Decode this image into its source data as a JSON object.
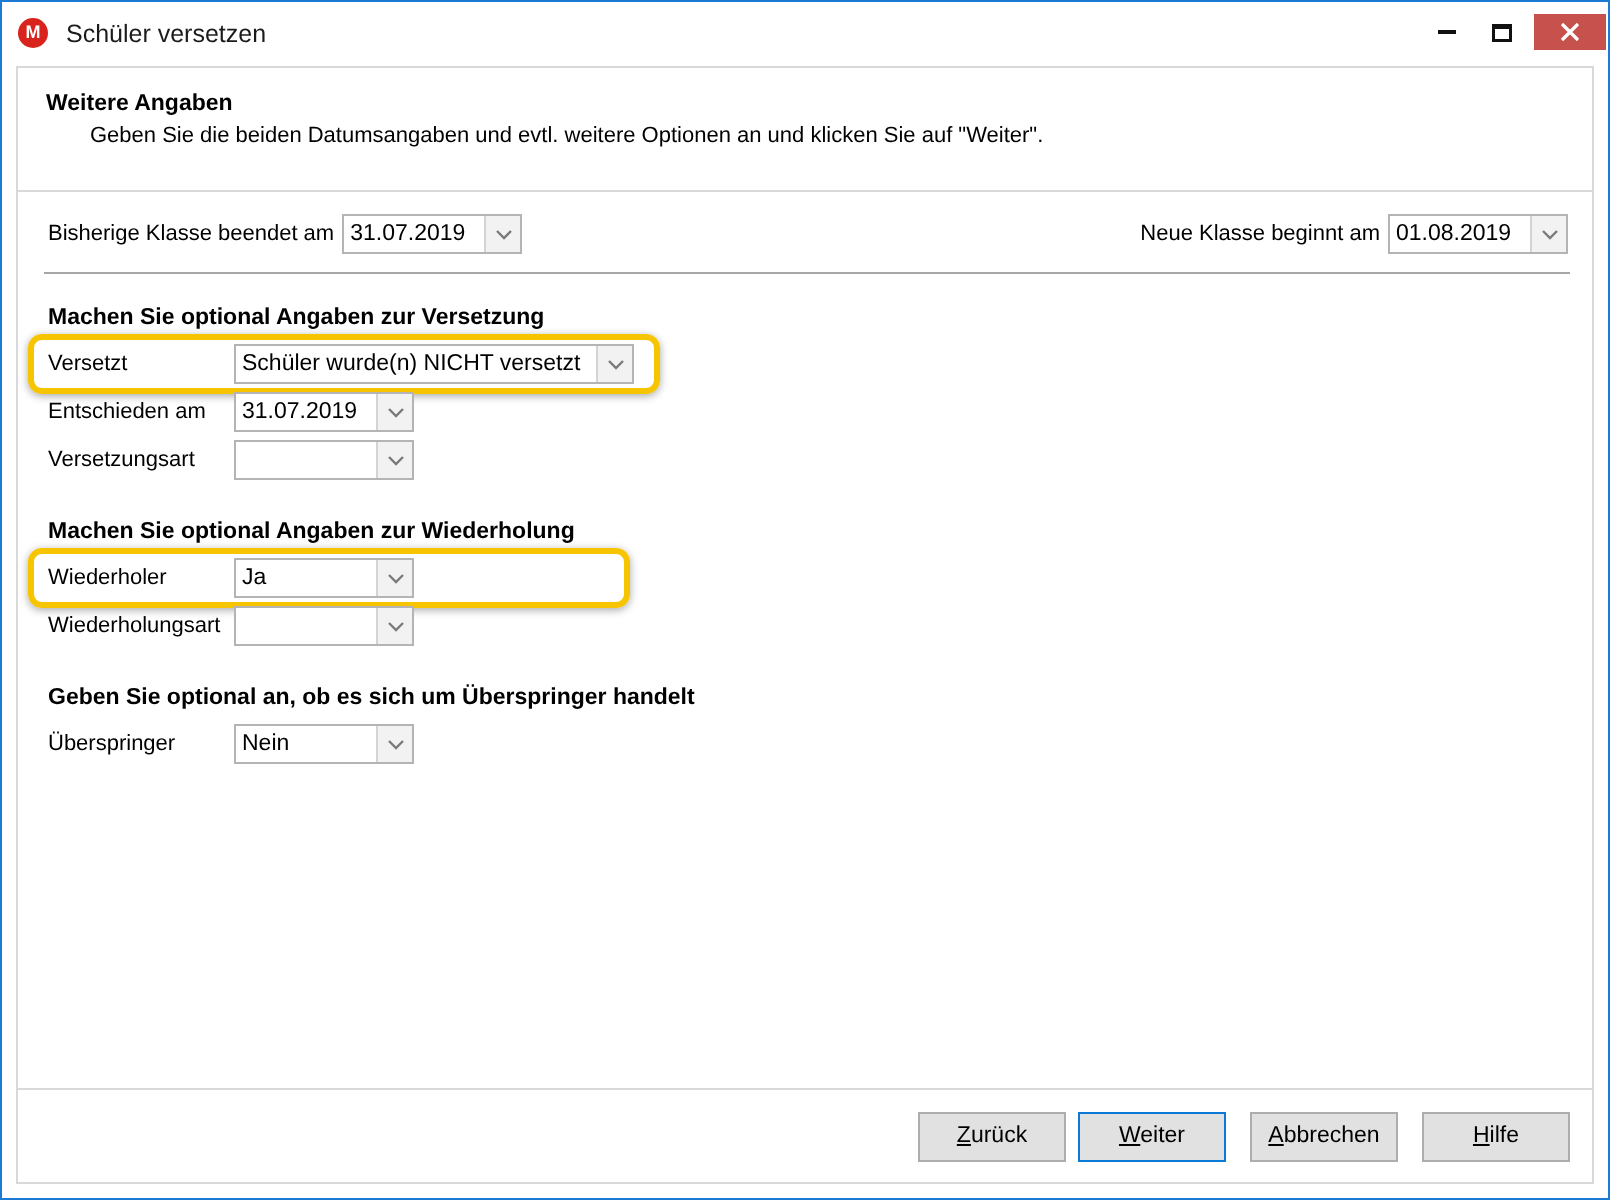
{
  "window": {
    "logo_letter": "M",
    "title": "Schüler versetzen"
  },
  "header": {
    "title": "Weitere Angaben",
    "description": "Geben Sie die beiden Datumsangaben und evtl. weitere Optionen an und klicken Sie auf \"Weiter\"."
  },
  "dates": [
    {
      "label": "Bisherige Klasse beendet am",
      "value": "31.07.2019"
    },
    {
      "label": "Neue Klasse beginnt am",
      "value": "01.08.2019"
    }
  ],
  "sections": [
    {
      "heading": "Machen Sie optional Angaben zur Versetzung",
      "fields": [
        {
          "label": "Versetzt",
          "value": "Schüler wurde(n) NICHT versetzt",
          "highlighted": true
        },
        {
          "label": "Entschieden am",
          "value": "31.07.2019",
          "highlighted": false
        },
        {
          "label": "Versetzungsart",
          "highlighted": false
        }
      ]
    },
    {
      "heading": "Machen Sie optional Angaben zur Wiederholung",
      "fields": [
        {
          "label": "Wiederholer",
          "value": "Ja",
          "highlighted": true
        },
        {
          "label": "Wiederholungsart",
          "highlighted": false
        }
      ]
    },
    {
      "heading": "Geben Sie optional an, ob es sich um Überspringer handelt",
      "fields": [
        {
          "label": "Überspringer",
          "value": "Nein",
          "highlighted": false
        }
      ]
    }
  ],
  "buttons": [
    {
      "label": "Zurück",
      "focused": false,
      "access_key_underlined": true
    },
    {
      "label": "Weiter",
      "focused": true,
      "access_key_underlined": true
    },
    {
      "label": "Abbrechen",
      "focused": false,
      "access_key_underlined": true
    },
    {
      "label": "Hilfe",
      "focused": false,
      "access_key_underlined": true
    }
  ]
}
